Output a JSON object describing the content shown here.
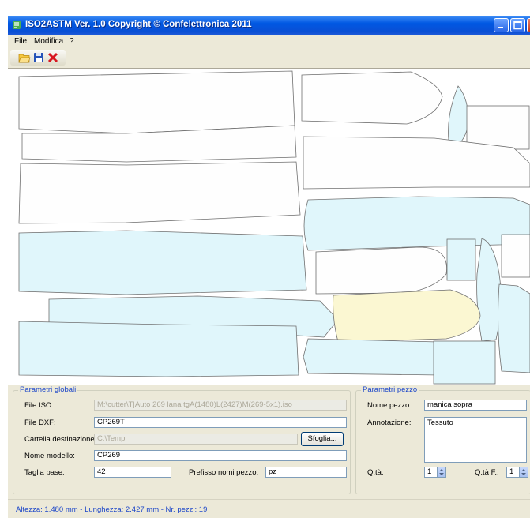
{
  "window": {
    "title": "ISO2ASTM Ver. 1.0 Copyright © Confelettronica 2011"
  },
  "menu": {
    "items": [
      {
        "label": "File"
      },
      {
        "label": "Modifica"
      },
      {
        "label": "?"
      }
    ]
  },
  "toolbar": {
    "buttons": [
      {
        "icon": "open-folder-icon"
      },
      {
        "icon": "save-disk-icon"
      },
      {
        "icon": "close-x-icon"
      }
    ]
  },
  "global_params": {
    "title": "Parametri globali",
    "file_iso_label": "File ISO:",
    "file_iso_value": "M:\\cutter\\T|Auto 269 lana tgA(1480)L(2427)M(269-5x1).iso",
    "file_dxf_label": "File DXF:",
    "file_dxf_value": "CP269T",
    "dest_folder_label": "Cartella destinazione:",
    "dest_folder_value": "C:\\Temp",
    "browse_label": "Sfoglia...",
    "model_name_label": "Nome modello:",
    "model_name_value": "CP269",
    "base_size_label": "Taglia base:",
    "base_size_value": "42",
    "piece_prefix_label": "Prefisso nomi pezzo:",
    "piece_prefix_value": "pz"
  },
  "piece_params": {
    "title": "Parametri pezzo",
    "piece_name_label": "Nome pezzo:",
    "piece_name_value": "manica sopra",
    "annotation_label": "Annotazione:",
    "annotation_value": "Tessuto",
    "qty_label": "Q.tà:",
    "qty_value": "1",
    "qty_f_label": "Q.tà F.:",
    "qty_f_value": "1"
  },
  "status": {
    "text": "Altezza: 1.480 mm - Lunghezza: 2.427 mm - Nr. pezzi: 19"
  },
  "colors": {
    "piece_default": "#fefefe",
    "piece_cyan": "#e0f6fb",
    "piece_selected": "#fbf7d2",
    "group_title": "#1c46c8"
  }
}
